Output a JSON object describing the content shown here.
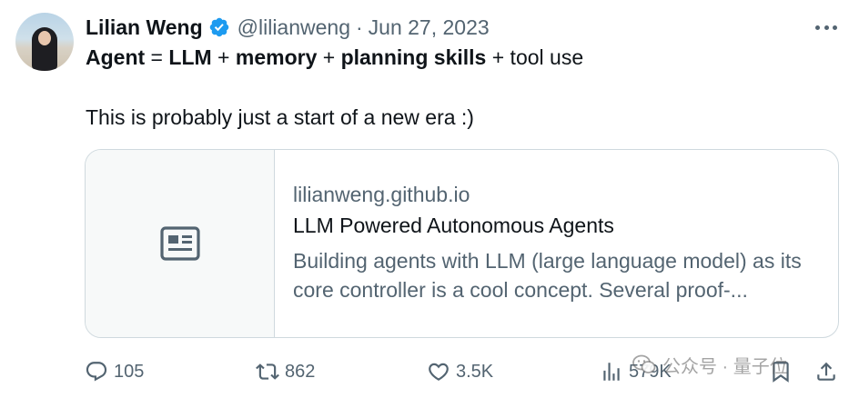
{
  "author": {
    "name": "Lilian Weng",
    "handle": "@lilianweng",
    "separator": "·",
    "date": "Jun 27, 2023"
  },
  "icons": {
    "verified": "verified-badge-icon",
    "more": "more-options-icon",
    "card_media": "article-icon",
    "reply": "reply-icon",
    "retweet": "retweet-icon",
    "like": "heart-icon",
    "views": "views-icon",
    "bookmark": "bookmark-icon",
    "share": "share-icon"
  },
  "colors": {
    "verified": "#1d9bf0",
    "secondary_text": "#536471",
    "border": "#cfd9de"
  },
  "tweet": {
    "line1": {
      "agent": "Agent",
      "eq": " = ",
      "llm": "LLM",
      "plus1": " + ",
      "memory": "memory",
      "plus2": " + ",
      "planning": "planning skills",
      "tail": " + tool use"
    },
    "line2": "This is probably just a start of a new era :)"
  },
  "card": {
    "domain": "lilianweng.github.io",
    "title": "LLM Powered Autonomous Agents",
    "description": "Building agents with LLM (large language model) as its core controller is a cool concept. Several proof-..."
  },
  "stats": {
    "replies": "105",
    "retweets": "862",
    "likes": "3.5K",
    "views": "579K"
  },
  "watermark": {
    "text": "公众号 · 量子位"
  }
}
